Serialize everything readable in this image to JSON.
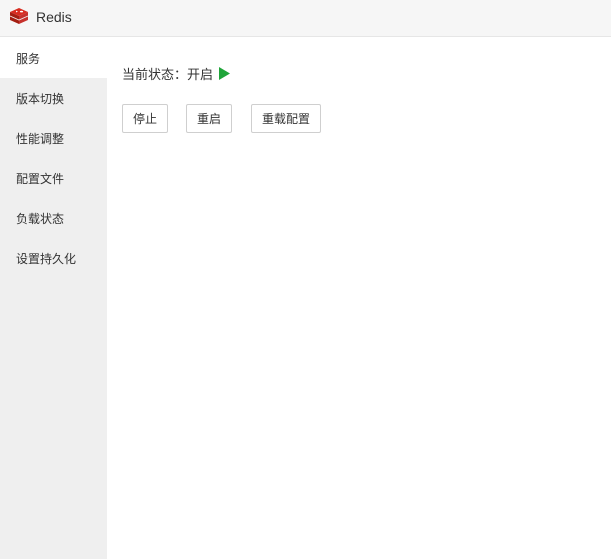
{
  "app": {
    "title": "Redis",
    "logo_icon": "redis-logo-icon"
  },
  "sidebar": {
    "items": [
      {
        "label": "服务",
        "active": true
      },
      {
        "label": "版本切换",
        "active": false
      },
      {
        "label": "性能调整",
        "active": false
      },
      {
        "label": "配置文件",
        "active": false
      },
      {
        "label": "负载状态",
        "active": false
      },
      {
        "label": "设置持久化",
        "active": false
      }
    ]
  },
  "main": {
    "status_label": "当前状态：",
    "status_value": "开启",
    "status_icon": "play-icon",
    "status_color": "#20a53a",
    "buttons": {
      "stop": "停止",
      "restart": "重启",
      "reload": "重载配置"
    }
  }
}
